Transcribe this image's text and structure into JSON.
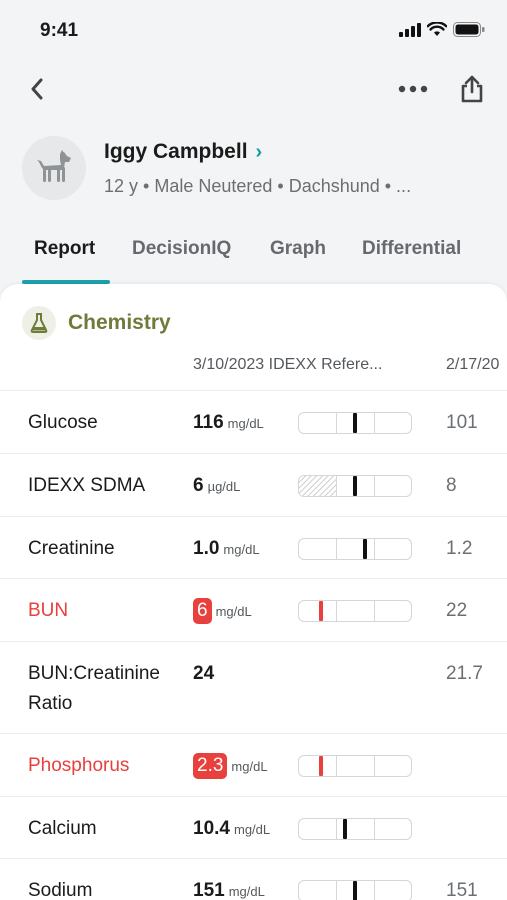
{
  "status_bar": {
    "time": "9:41"
  },
  "patient": {
    "name": "Iggy Campbell",
    "meta": "12 y • Male Neutered • Dachshund • ..."
  },
  "tabs": [
    {
      "label": "Report"
    },
    {
      "label": "DecisionIQ"
    },
    {
      "label": "Graph"
    },
    {
      "label": "Differential"
    }
  ],
  "section": {
    "title": "Chemistry"
  },
  "columns": {
    "current": "3/10/2023 IDEXX Refere...",
    "previous": "2/17/20"
  },
  "rows": [
    {
      "name": "Glucose",
      "value": "116",
      "unit": "mg/dL",
      "previous": "101",
      "flag": false,
      "range_position": 0.5
    },
    {
      "name": "IDEXX SDMA",
      "value": "6",
      "unit": "µg/dL",
      "previous": "8",
      "flag": false,
      "range_position": 0.5
    },
    {
      "name": "Creatinine",
      "value": "1.0",
      "unit": "mg/dL",
      "previous": "1.2",
      "flag": false,
      "range_position": 0.59
    },
    {
      "name": "BUN",
      "value": "6",
      "unit": "mg/dL",
      "previous": "22",
      "flag": true,
      "range_position": 0.2
    },
    {
      "name": "BUN:Creatinine",
      "name2": "Ratio",
      "value": "24",
      "unit": "",
      "previous": "21.7",
      "flag": false
    },
    {
      "name": "Phosphorus",
      "value": "2.3",
      "unit": "mg/dL",
      "previous": "",
      "flag": true,
      "range_position": 0.2
    },
    {
      "name": "Calcium",
      "value": "10.4",
      "unit": "mg/dL",
      "previous": "",
      "flag": false,
      "range_position": 0.41
    },
    {
      "name": "Sodium",
      "value": "151",
      "unit": "mg/dL",
      "previous": "151",
      "flag": false,
      "range_position": 0.5
    }
  ],
  "colors": {
    "accent": "#1aa2ad",
    "flag": "#e8403c",
    "section": "#6e7b3b"
  }
}
